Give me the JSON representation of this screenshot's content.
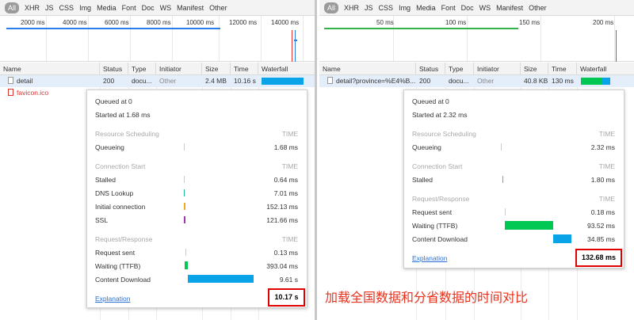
{
  "filters": [
    "All",
    "XHR",
    "JS",
    "CSS",
    "Img",
    "Media",
    "Font",
    "Doc",
    "WS",
    "Manifest",
    "Other"
  ],
  "columns": [
    "Name",
    "Status",
    "Type",
    "Initiator",
    "Size",
    "Time",
    "Waterfall"
  ],
  "colors": {
    "queue_tick": "#cccccc",
    "dns": "#1fb99a",
    "connect": "#f5a623",
    "ssl": "#a82fb8",
    "waiting": "#00c853",
    "download": "#0aa3e8",
    "overview_blue": "#2b7de9",
    "overview_green": "#2fb34a",
    "overview_red": "#e53935",
    "highlight_box": "#e00000",
    "annotation": "#e8321e"
  },
  "left": {
    "overview_ticks": [
      "2000 ms",
      "4000 ms",
      "6000 ms",
      "8000 ms",
      "10000 ms",
      "12000 ms",
      "14000 ms"
    ],
    "rows": [
      {
        "name": "detail",
        "status": "200",
        "type": "docu...",
        "initiator": "Other",
        "size": "2.4 MB",
        "time": "10.16 s"
      },
      {
        "name": "favicon.ico"
      }
    ],
    "timing": {
      "queued_at": "Queued at 0",
      "started_at": "Started at 1.68 ms",
      "sections": [
        {
          "title": "Resource Scheduling",
          "time_header": "TIME",
          "items": [
            {
              "label": "Queueing",
              "value": "1.68 ms"
            }
          ]
        },
        {
          "title": "Connection Start",
          "time_header": "TIME",
          "items": [
            {
              "label": "Stalled",
              "value": "0.64 ms"
            },
            {
              "label": "DNS Lookup",
              "value": "7.01 ms"
            },
            {
              "label": "Initial connection",
              "value": "152.13 ms"
            },
            {
              "label": "SSL",
              "value": "121.66 ms"
            }
          ]
        },
        {
          "title": "Request/Response",
          "time_header": "TIME",
          "items": [
            {
              "label": "Request sent",
              "value": "0.13 ms"
            },
            {
              "label": "Waiting (TTFB)",
              "value": "393.04 ms"
            },
            {
              "label": "Content Download",
              "value": "9.61 s"
            }
          ]
        }
      ],
      "explanation": "Explanation",
      "total": "10.17 s"
    }
  },
  "right": {
    "overview_ticks": [
      "50 ms",
      "100 ms",
      "150 ms",
      "200 ms"
    ],
    "rows": [
      {
        "name": "detail?province=%E4%B...",
        "status": "200",
        "type": "docu...",
        "initiator": "Other",
        "size": "40.8 KB",
        "time": "130 ms"
      }
    ],
    "timing": {
      "queued_at": "Queued at 0",
      "started_at": "Started at 2.32 ms",
      "sections": [
        {
          "title": "Resource Scheduling",
          "time_header": "TIME",
          "items": [
            {
              "label": "Queueing",
              "value": "2.32 ms"
            }
          ]
        },
        {
          "title": "Connection Start",
          "time_header": "TIME",
          "items": [
            {
              "label": "Stalled",
              "value": "1.80 ms"
            }
          ]
        },
        {
          "title": "Request/Response",
          "time_header": "TIME",
          "items": [
            {
              "label": "Request sent",
              "value": "0.18 ms"
            },
            {
              "label": "Waiting (TTFB)",
              "value": "93.52 ms"
            },
            {
              "label": "Content Download",
              "value": "34.85 ms"
            }
          ]
        }
      ],
      "explanation": "Explanation",
      "total": "132.68 ms"
    }
  },
  "annotation": "加载全国数据和分省数据的时间对比"
}
